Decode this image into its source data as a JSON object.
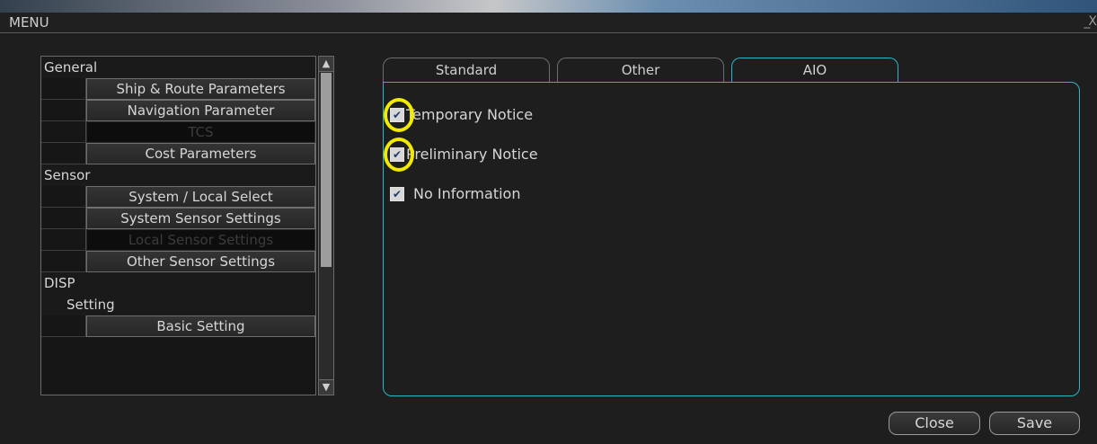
{
  "window": {
    "title": "MENU",
    "controls": "_X"
  },
  "menu": {
    "items": [
      {
        "type": "category",
        "label": "General"
      },
      {
        "type": "button",
        "label": "Ship & Route Parameters",
        "enabled": true
      },
      {
        "type": "button",
        "label": "Navigation Parameter",
        "enabled": true
      },
      {
        "type": "button",
        "label": "TCS",
        "enabled": false
      },
      {
        "type": "button",
        "label": "Cost Parameters",
        "enabled": true
      },
      {
        "type": "category",
        "label": "Sensor"
      },
      {
        "type": "button",
        "label": "System / Local Select",
        "enabled": true
      },
      {
        "type": "button",
        "label": "System Sensor Settings",
        "enabled": true
      },
      {
        "type": "button",
        "label": "Local Sensor Settings",
        "enabled": false
      },
      {
        "type": "button",
        "label": "Other Sensor Settings",
        "enabled": true
      },
      {
        "type": "category",
        "label": "DISP"
      },
      {
        "type": "subcategory",
        "label": "Setting"
      },
      {
        "type": "button",
        "label": "Basic Setting",
        "enabled": true
      }
    ]
  },
  "tabs": [
    {
      "label": "Standard",
      "active": false
    },
    {
      "label": "Other",
      "active": false
    },
    {
      "label": "AIO",
      "active": true
    }
  ],
  "options": [
    {
      "label": "Temporary Notice",
      "checked": true,
      "highlighted": true
    },
    {
      "label": "Preliminary Notice",
      "checked": true,
      "highlighted": true
    },
    {
      "label": "No Information",
      "checked": true,
      "highlighted": false
    }
  ],
  "footer": {
    "close_label": "Close",
    "save_label": "Save"
  },
  "colors": {
    "accent": "#2cb6c9",
    "highlight": "#f2ea00"
  }
}
